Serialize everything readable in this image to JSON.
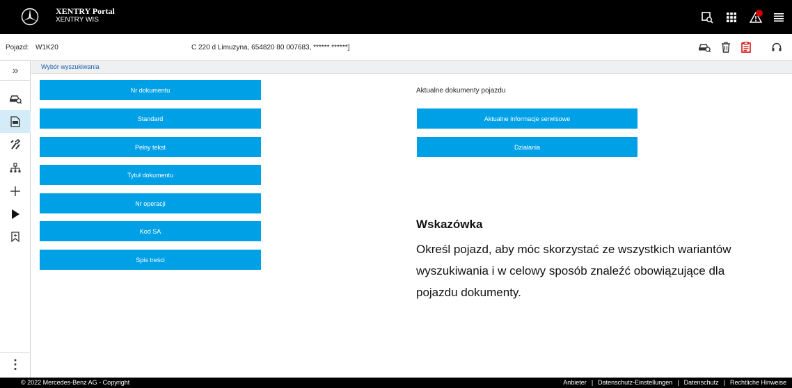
{
  "header": {
    "title": "XENTRY Portal",
    "subtitle": "XENTRY WIS",
    "icons": [
      "portal-screen-icon",
      "apps-grid-icon",
      "warning-icon",
      "menu-icon"
    ],
    "alert_color": "#d40000"
  },
  "vehicle": {
    "label": "Pojazd:",
    "id": "W1K20",
    "description": "C 220 d Limuzyna, 654820 80 007683, ****** ******]",
    "icons": [
      "vehicle-search-icon",
      "trash-icon",
      "document-icon",
      "headset-icon"
    ]
  },
  "sidebar": {
    "collapse": "»",
    "items": [
      {
        "name": "vehicle-icon",
        "active": false
      },
      {
        "name": "wis-document-icon",
        "active": true
      },
      {
        "name": "tools-icon",
        "active": false
      },
      {
        "name": "structure-icon",
        "active": false
      },
      {
        "name": "plus-icon",
        "active": false
      },
      {
        "name": "play-icon",
        "active": false
      },
      {
        "name": "bookmark-icon",
        "active": false
      }
    ],
    "more": "⋮"
  },
  "breadcrumb": "Wybór wyszukiwania",
  "search_buttons": [
    "Nr dokumentu",
    "Standard",
    "Pełny tekst",
    "Tytuł dokumentu",
    "Nr operacji",
    "Kod SA",
    "Spis treści"
  ],
  "current_docs": {
    "title": "Aktualne dokumenty pojazdu",
    "buttons": [
      "Aktualne informacje serwisowe",
      "Działania"
    ]
  },
  "hint": {
    "title": "Wskazówka",
    "text": "Określ pojazd, aby móc skorzystać ze wszystkich wariantów wyszukiwania i w celowy sposób znaleźć obowiązujące dla pojazdu dokumenty."
  },
  "footer": {
    "copyright": "© 2022 Mercedes-Benz AG - Copyright",
    "links": [
      "Anbieter",
      "Datenschutz-Einstellungen",
      "Datenschutz",
      "Rechtliche Hinweise"
    ],
    "separator": "|"
  },
  "colors": {
    "accent": "#00a0e6",
    "active_sidebar": "#d4ecf7",
    "link": "#1d5fa6"
  }
}
